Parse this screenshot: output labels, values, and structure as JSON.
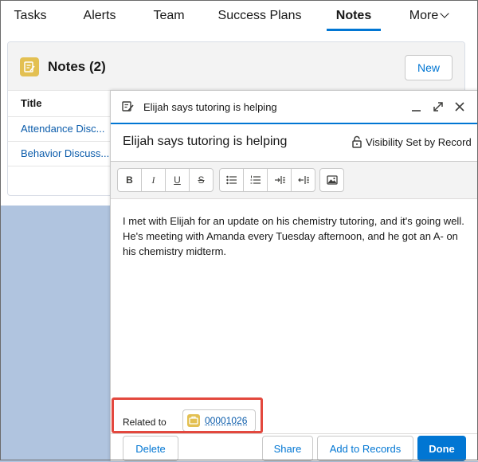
{
  "tabs": [
    {
      "label": "Tasks"
    },
    {
      "label": "Alerts"
    },
    {
      "label": "Team"
    },
    {
      "label": "Success Plans"
    },
    {
      "label": "Notes"
    },
    {
      "label": "More"
    }
  ],
  "notes_card": {
    "title": "Notes (2)",
    "new_label": "New",
    "column_title": "Title",
    "rows": [
      {
        "title": "Attendance Disc..."
      },
      {
        "title": "Behavior Discuss..."
      }
    ]
  },
  "composer": {
    "header_title": "Elijah says tutoring is helping",
    "note_title": "Elijah says tutoring is helping",
    "visibility": "Visibility Set by Record",
    "toolbar": {
      "bold": "B",
      "italic": "I",
      "underline": "U",
      "strike": "S"
    },
    "body": "I met with Elijah for an update on his chemistry tutoring, and it's going well. He's meeting with Amanda every Tuesday afternoon, and he got an A- on his chemistry midterm.",
    "related_label": "Related to",
    "related_record": "00001026",
    "buttons": {
      "delete": "Delete",
      "share": "Share",
      "add_to_records": "Add to Records",
      "done": "Done"
    }
  },
  "colors": {
    "accent": "#0176d3",
    "notes_icon": "#e3c052",
    "highlight": "#e3483e",
    "background": "#b0c4df"
  }
}
